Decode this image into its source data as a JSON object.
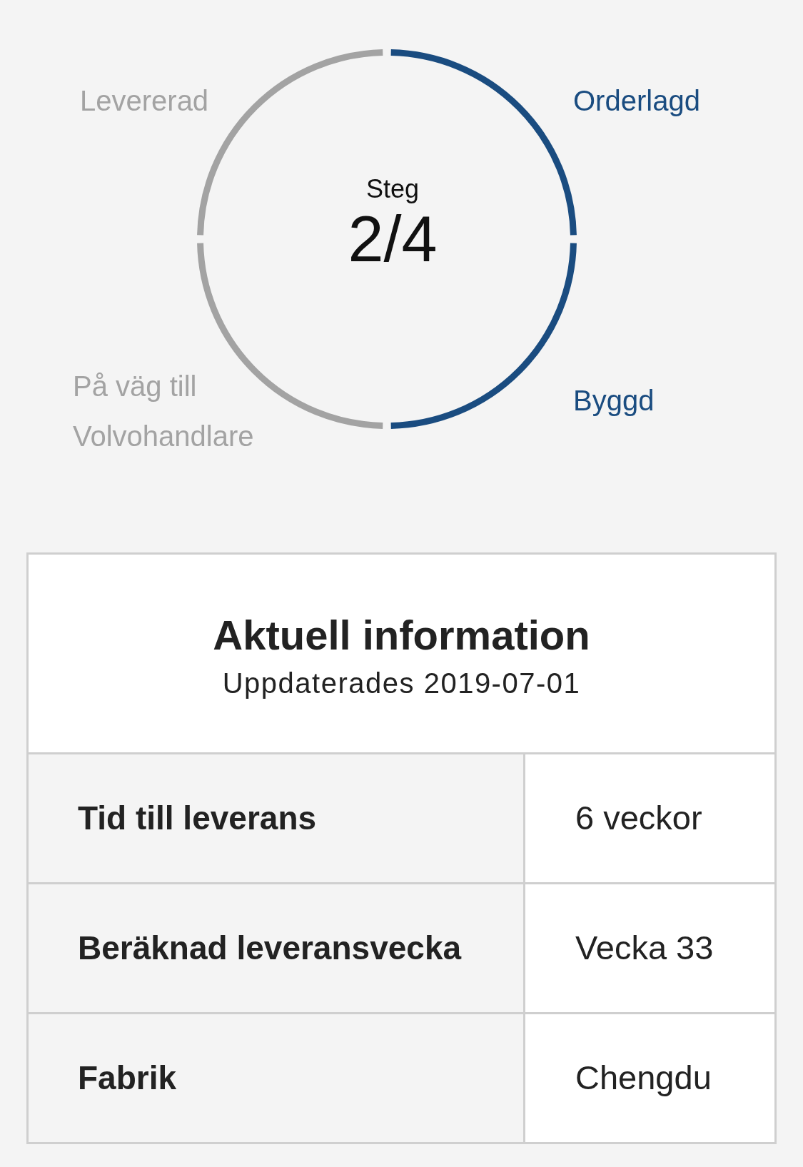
{
  "progress": {
    "caption": "Steg",
    "value": "2/4",
    "steps": [
      {
        "label": "Levererad",
        "done": false
      },
      {
        "label": "Orderlagd",
        "done": true
      },
      {
        "label": "På väg till Volvohandlare",
        "done": false
      },
      {
        "label": "Byggd",
        "done": true
      }
    ]
  },
  "info": {
    "title": "Aktuell information",
    "updated": "Uppdaterades 2019-07-01",
    "rows": [
      {
        "label": "Tid till leverans",
        "value": "6 veckor"
      },
      {
        "label": "Beräknad leveransvecka",
        "value": "Vecka 33"
      },
      {
        "label": "Fabrik",
        "value": "Chengdu"
      }
    ]
  }
}
